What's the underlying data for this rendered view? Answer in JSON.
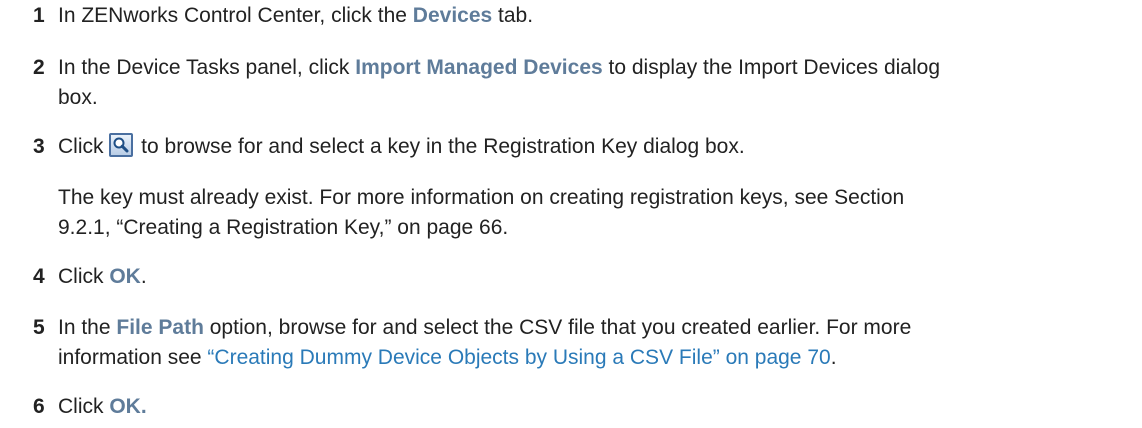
{
  "steps": [
    {
      "number": "1",
      "before": "In ZENworks Control Center, click the ",
      "ui_term": "Devices",
      "after": " tab."
    },
    {
      "number": "2",
      "before": "In the Device Tasks panel, click ",
      "ui_term": "Import Managed Devices",
      "after_line1": " to display the Import Devices dialog",
      "after_line2": "box."
    },
    {
      "number": "3",
      "before": "Click ",
      "icon": "search-icon",
      "after": " to browse for and select a key in the Registration Key dialog box.",
      "note_line1": "The key must already exist. For more information on creating registration keys, see Section",
      "note_line2": "9.2.1, “Creating a Registration Key,” on page 66."
    },
    {
      "number": "4",
      "before": "Click ",
      "ui_term": "OK",
      "after": "."
    },
    {
      "number": "5",
      "before": "In the ",
      "ui_term": "File Path",
      "after_line1": " option, browse for and select the CSV file that you created earlier. For more",
      "line2_before": "information see ",
      "link_text": "“Creating Dummy Device Objects by Using a CSV File” on page 70",
      "line2_after": "."
    },
    {
      "number": "6",
      "before": "Click ",
      "ui_term": "OK."
    }
  ]
}
